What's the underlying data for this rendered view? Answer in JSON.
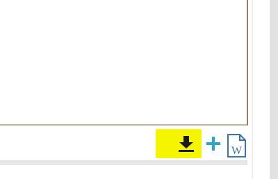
{
  "toolbar": {
    "download_icon": "download-icon",
    "add_icon": "plus-icon",
    "word_icon": "word-document-icon",
    "word_letter": "W"
  },
  "colors": {
    "highlight": "#f5f500",
    "add_accent": "#2aa6c9",
    "word_blue": "#3b6fb6",
    "pane_border": "#a07a5c"
  }
}
